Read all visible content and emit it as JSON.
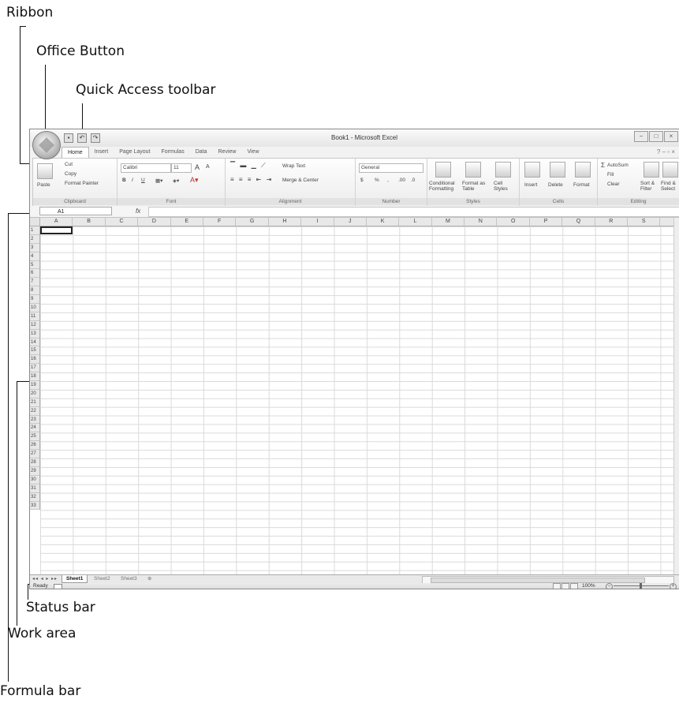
{
  "callouts": {
    "ribbon": "Ribbon",
    "office_button": "Office Button",
    "quick_access_toolbar": "Quick Access toolbar",
    "status_bar": "Status bar",
    "work_area": "Work area",
    "formula_bar": "Formula bar"
  },
  "window": {
    "title": "Book1 - Microsoft Excel",
    "controls": [
      "−",
      "□",
      "×"
    ]
  },
  "quick_access": {
    "save_icon": "save-icon",
    "undo_icon": "undo-icon",
    "redo_icon": "redo-icon"
  },
  "tabs": [
    "Home",
    "Insert",
    "Page Layout",
    "Formulas",
    "Data",
    "Review",
    "View"
  ],
  "ribbon": {
    "clipboard": {
      "label": "Clipboard",
      "paste": "Paste",
      "cut": "Cut",
      "copy": "Copy",
      "format_painter": "Format Painter"
    },
    "font": {
      "label": "Font",
      "font_name": "Calibri",
      "font_size": "11",
      "bold": "B",
      "italic": "I",
      "underline": "U",
      "grow": "A",
      "shrink": "A"
    },
    "alignment": {
      "label": "Alignment",
      "wrap_text": "Wrap Text",
      "merge_center": "Merge & Center"
    },
    "number": {
      "label": "Number",
      "format": "General",
      "currency": "$",
      "percent": "%",
      "comma": ",",
      "inc_dec": ".00",
      "dec_dec": ".0"
    },
    "styles": {
      "label": "Styles",
      "conditional": "Conditional Formatting",
      "format_table": "Format as Table",
      "cell_styles": "Cell Styles"
    },
    "cells": {
      "label": "Cells",
      "insert": "Insert",
      "delete": "Delete",
      "format": "Format"
    },
    "editing": {
      "label": "Editing",
      "autosum": "AutoSum",
      "fill": "Fill",
      "clear": "Clear",
      "sort_filter": "Sort & Filter",
      "find_select": "Find & Select"
    }
  },
  "formula_bar": {
    "name_box": "A1",
    "fx": "fx",
    "content": ""
  },
  "columns": [
    "A",
    "B",
    "C",
    "D",
    "E",
    "F",
    "G",
    "H",
    "I",
    "J",
    "K",
    "L",
    "M",
    "N",
    "O",
    "P",
    "Q",
    "R",
    "S"
  ],
  "rows": [
    "1",
    "2",
    "3",
    "4",
    "5",
    "6",
    "7",
    "8",
    "9",
    "10",
    "11",
    "12",
    "13",
    "14",
    "15",
    "16",
    "17",
    "18",
    "19",
    "20",
    "21",
    "22",
    "23",
    "24",
    "25",
    "26",
    "27",
    "28",
    "29",
    "30",
    "31",
    "32",
    "33"
  ],
  "sheets": [
    "Sheet1",
    "Sheet2",
    "Sheet3"
  ],
  "status": {
    "text": "Ready",
    "zoom": "100%"
  }
}
